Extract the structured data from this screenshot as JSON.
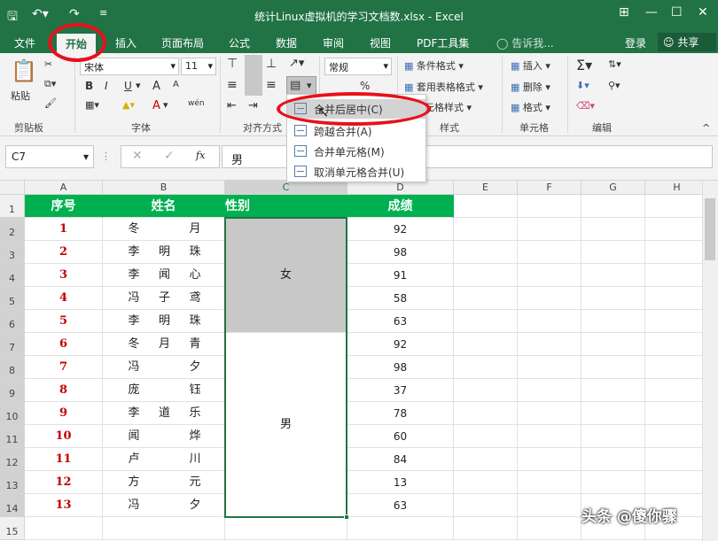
{
  "window": {
    "title": "统计Linux虚拟机的学习文档数.xlsx - Excel",
    "controls": [
      "⊞",
      "—",
      "☐",
      "✕"
    ]
  },
  "tabs": [
    "文件",
    "开始",
    "插入",
    "页面布局",
    "公式",
    "数据",
    "审阅",
    "视图",
    "PDF工具集"
  ],
  "active_tab": "开始",
  "tell_me": "告诉我...",
  "login": "登录",
  "share": "共享",
  "ribbon": {
    "clipboard": {
      "paste": "粘贴",
      "label": "剪贴板"
    },
    "font": {
      "name": "宋体",
      "size": "11",
      "label": "字体",
      "bold": "B",
      "italic": "I",
      "underline": "U",
      "grow": "A",
      "shrink": "A",
      "color_a": "A",
      "wen": "wén"
    },
    "alignment": {
      "label": "对齐方式"
    },
    "number": {
      "format": "常规",
      "percent": "%"
    },
    "styles": {
      "cond": "条件格式",
      "table": "套用表格格式",
      "cell": "单元格样式",
      "label": "样式"
    },
    "cells": {
      "insert": "插入",
      "delete": "删除",
      "format": "格式",
      "label": "单元格"
    },
    "editing": {
      "label": "编辑"
    }
  },
  "merge_menu": {
    "items": [
      "合并后居中(C)",
      "跨越合并(A)",
      "合并单元格(M)",
      "取消单元格合并(U)"
    ],
    "highlighted": 0
  },
  "formula_bar": {
    "name_box": "C7",
    "fx": "fx",
    "value": "男"
  },
  "columns": [
    "A",
    "B",
    "C",
    "D",
    "E",
    "F",
    "G",
    "H"
  ],
  "rows": [
    "1",
    "2",
    "3",
    "4",
    "5",
    "6",
    "7",
    "8",
    "9",
    "10",
    "11",
    "12",
    "13",
    "14",
    "15"
  ],
  "table": {
    "headers": [
      "序号",
      "姓名",
      "性别",
      "成绩"
    ],
    "data": [
      {
        "no": "1",
        "name": [
          "冬",
          "",
          "月"
        ],
        "score": "92"
      },
      {
        "no": "2",
        "name": [
          "李",
          "明",
          "珠"
        ],
        "score": "98"
      },
      {
        "no": "3",
        "name": [
          "李",
          "闻",
          "心"
        ],
        "score": "91"
      },
      {
        "no": "4",
        "name": [
          "冯",
          "子",
          "鸢"
        ],
        "score": "58"
      },
      {
        "no": "5",
        "name": [
          "李",
          "明",
          "珠"
        ],
        "score": "63"
      },
      {
        "no": "6",
        "name": [
          "冬",
          "月",
          "青"
        ],
        "score": "92"
      },
      {
        "no": "7",
        "name": [
          "冯",
          "",
          "夕"
        ],
        "score": "98"
      },
      {
        "no": "8",
        "name": [
          "庞",
          "",
          "钰"
        ],
        "score": "37"
      },
      {
        "no": "9",
        "name": [
          "李",
          "道",
          "乐"
        ],
        "score": "78"
      },
      {
        "no": "10",
        "name": [
          "闻",
          "",
          "烨"
        ],
        "score": "60"
      },
      {
        "no": "11",
        "name": [
          "卢",
          "",
          "川"
        ],
        "score": "84"
      },
      {
        "no": "12",
        "name": [
          "方",
          "",
          "元"
        ],
        "score": "13"
      },
      {
        "no": "13",
        "name": [
          "冯",
          "",
          "夕"
        ],
        "score": "63"
      }
    ],
    "gender_female": "女",
    "gender_male": "男"
  },
  "watermark": "头条 @傻你骤",
  "colors": {
    "excel_green": "#217346",
    "header_fill": "#00b050",
    "number_red": "#c00000",
    "highlight_red": "#e8111b"
  }
}
